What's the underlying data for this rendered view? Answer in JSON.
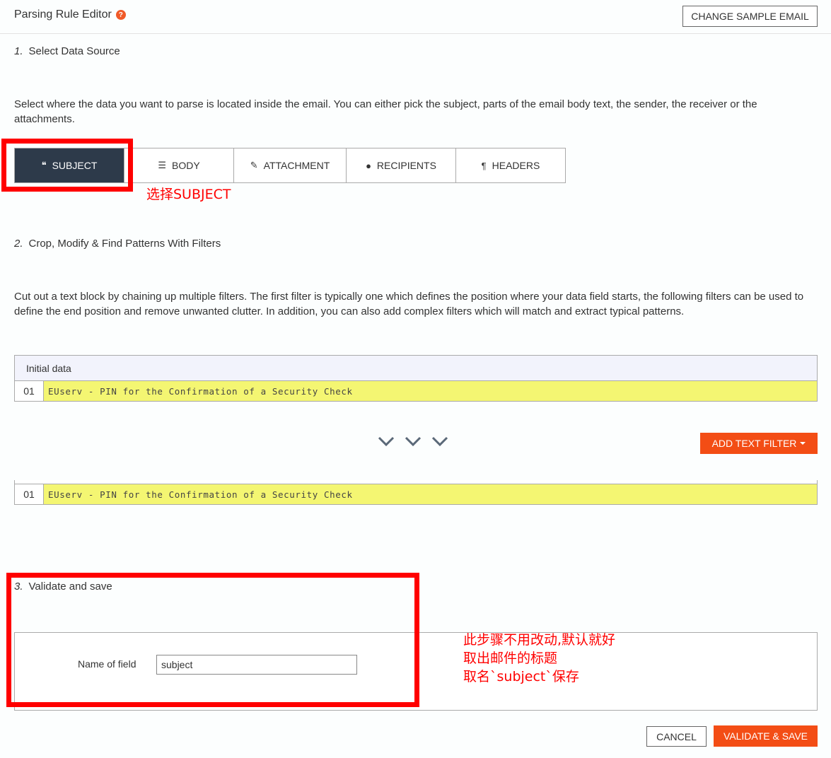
{
  "header": {
    "title": "Parsing Rule Editor",
    "help_icon": "question-circle-icon",
    "change_email_label": "CHANGE SAMPLE EMAIL"
  },
  "step1": {
    "number": "1.",
    "title": "Select Data Source",
    "description": "Select where the data you want to parse is located inside the email. You can either pick the subject, parts of the email body text, the sender, the receiver or the attachments."
  },
  "tabs": [
    {
      "label": "SUBJECT",
      "icon": "quote-icon",
      "active": true
    },
    {
      "label": "BODY",
      "icon": "align-left-icon",
      "active": false
    },
    {
      "label": "ATTACHMENT",
      "icon": "paperclip-icon",
      "active": false
    },
    {
      "label": "RECIPIENTS",
      "icon": "user-icon",
      "active": false
    },
    {
      "label": "HEADERS",
      "icon": "paragraph-icon",
      "active": false
    }
  ],
  "annotations": {
    "select_subject": "选择SUBJECT",
    "note_line1": "此步骤不用改动,默认就好",
    "note_line2": "取出邮件的标题",
    "note_line3": "取名`subject`保存",
    "color": "#ff0000"
  },
  "step2": {
    "number": "2.",
    "title": "Crop, Modify & Find Patterns With Filters",
    "description": "Cut out a text block by chaining up multiple filters. The first filter is typically one which defines the position where your data field starts, the following filters can be used to define the end position and remove unwanted clutter. In addition, you can also add complex filters which will match and extract typical patterns."
  },
  "initial_data": {
    "header": "Initial data",
    "rows": [
      {
        "line": "01",
        "text": "EUserv - PIN for the Confirmation of a Security Check"
      }
    ]
  },
  "add_text_filter_label": "ADD TEXT FILTER",
  "result_data": {
    "rows": [
      {
        "line": "01",
        "text": "EUserv - PIN for the Confirmation of a Security Check"
      }
    ]
  },
  "step3": {
    "number": "3.",
    "title": "Validate and save",
    "field_label": "Name of field",
    "field_value": "subject"
  },
  "footer": {
    "cancel_label": "CANCEL",
    "validate_label": "VALIDATE & SAVE"
  },
  "colors": {
    "accent": "#f34d15",
    "active_tab": "#2d3a4a",
    "highlight": "#f4f672"
  }
}
